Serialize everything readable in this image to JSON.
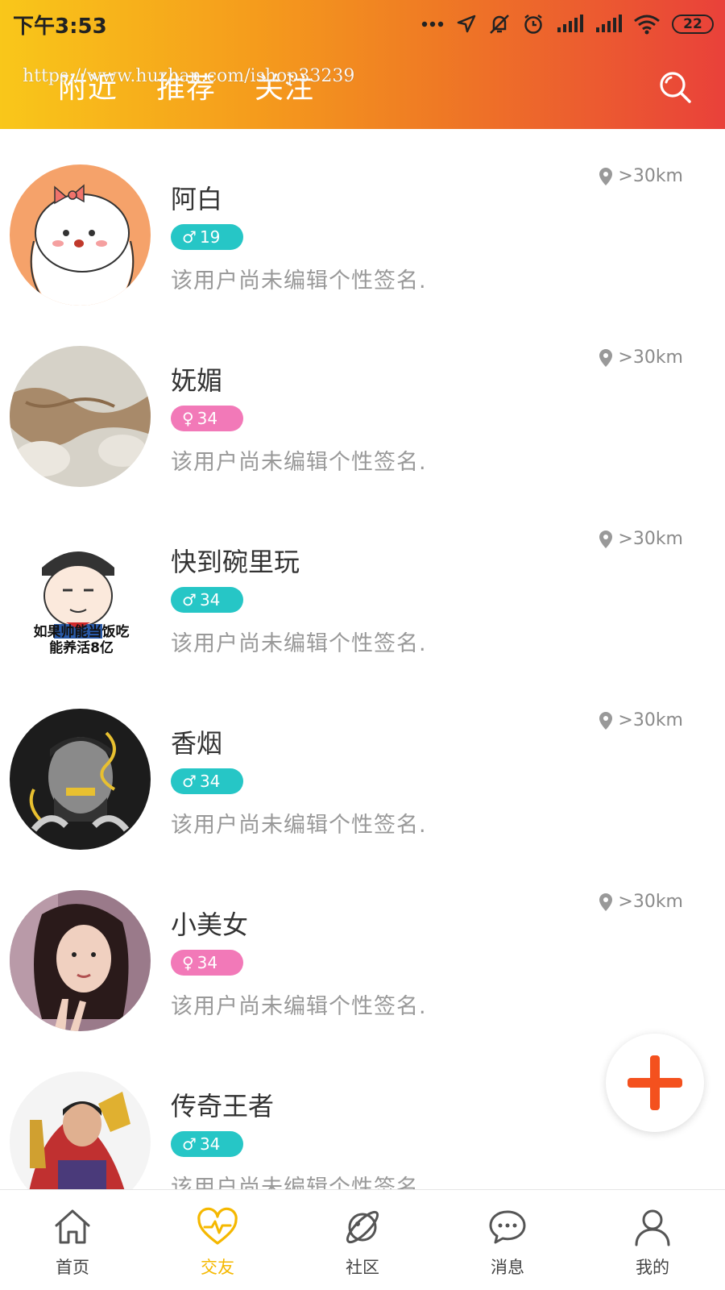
{
  "status_bar": {
    "time": "下午3:53",
    "battery": "22"
  },
  "header": {
    "tabs": [
      {
        "label": "附近"
      },
      {
        "label": "推荐"
      },
      {
        "label": "关注"
      }
    ],
    "watermark": "https://www.huzhan.com/ishop33239",
    "gradient_colors": [
      "#f9c71a",
      "#ef7a24",
      "#e9413a"
    ]
  },
  "users": [
    {
      "name": "阿白",
      "gender": "male",
      "gender_symbol": "♂",
      "age": "19",
      "signature": "该用户尚未编辑个性签名.",
      "distance": ">30km"
    },
    {
      "name": "妩媚",
      "gender": "female",
      "gender_symbol": "♀",
      "age": "34",
      "signature": "该用户尚未编辑个性签名.",
      "distance": ">30km"
    },
    {
      "name": "快到碗里玩",
      "gender": "male",
      "gender_symbol": "♂",
      "age": "34",
      "signature": "该用户尚未编辑个性签名.",
      "distance": ">30km"
    },
    {
      "name": "香烟",
      "gender": "male",
      "gender_symbol": "♂",
      "age": "34",
      "signature": "该用户尚未编辑个性签名.",
      "distance": ">30km"
    },
    {
      "name": "小美女",
      "gender": "female",
      "gender_symbol": "♀",
      "age": "34",
      "signature": "该用户尚未编辑个性签名.",
      "distance": ">30km"
    },
    {
      "name": "传奇王者",
      "gender": "male",
      "gender_symbol": "♂",
      "age": "34",
      "signature": "该用户尚未编辑个性签名.",
      "distance": ""
    }
  ],
  "avatar_texts": {
    "meme_caption_1": "如果帅能当饭吃",
    "meme_caption_2": "能养活8亿"
  },
  "fab": {
    "icon": "plus-icon",
    "color": "#f4511e"
  },
  "bottom_nav": [
    {
      "label": "首页",
      "icon": "home-icon"
    },
    {
      "label": "交友",
      "icon": "heart-pulse-icon",
      "active": true
    },
    {
      "label": "社区",
      "icon": "planet-icon"
    },
    {
      "label": "消息",
      "icon": "chat-icon"
    },
    {
      "label": "我的",
      "icon": "person-icon"
    }
  ],
  "colors": {
    "male_badge": "#26c6c6",
    "female_badge": "#f279b8",
    "active_nav": "#f5b800"
  }
}
